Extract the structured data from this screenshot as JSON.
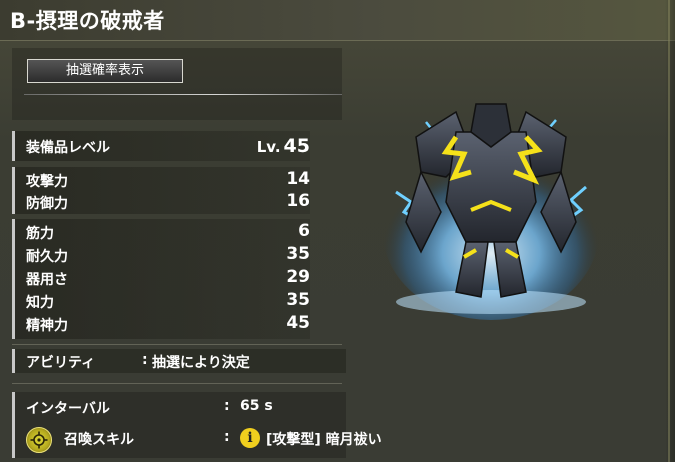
{
  "header": {
    "title": "B-摂理の破戒者"
  },
  "lottery_button": {
    "label": "抽選確率表示"
  },
  "level": {
    "label": "装備品レベル",
    "prefix": "Lv.",
    "value": "45"
  },
  "combat": [
    {
      "label": "攻撃力",
      "value": "14"
    },
    {
      "label": "防御力",
      "value": "16"
    }
  ],
  "attributes": [
    {
      "label": "筋力",
      "value": "6"
    },
    {
      "label": "耐久力",
      "value": "35"
    },
    {
      "label": "器用さ",
      "value": "29"
    },
    {
      "label": "知力",
      "value": "35"
    },
    {
      "label": "精神力",
      "value": "45"
    }
  ],
  "ability": {
    "label": "アビリティ",
    "colon": ":",
    "value": "抽選により決定"
  },
  "interval": {
    "label": "インターバル",
    "colon": ":",
    "value": "65 s"
  },
  "summon_skill": {
    "label": "召喚スキル",
    "colon": ":",
    "value": "[攻撃型] 暗月祓い",
    "info_glyph": "i"
  },
  "icons": {
    "skill": "crosshair-target-icon",
    "info": "info-icon"
  },
  "colors": {
    "accent_yellow": "#f0cf1e",
    "aura_blue": "#5fb8ff",
    "monster_gold": "#f5e11a"
  }
}
